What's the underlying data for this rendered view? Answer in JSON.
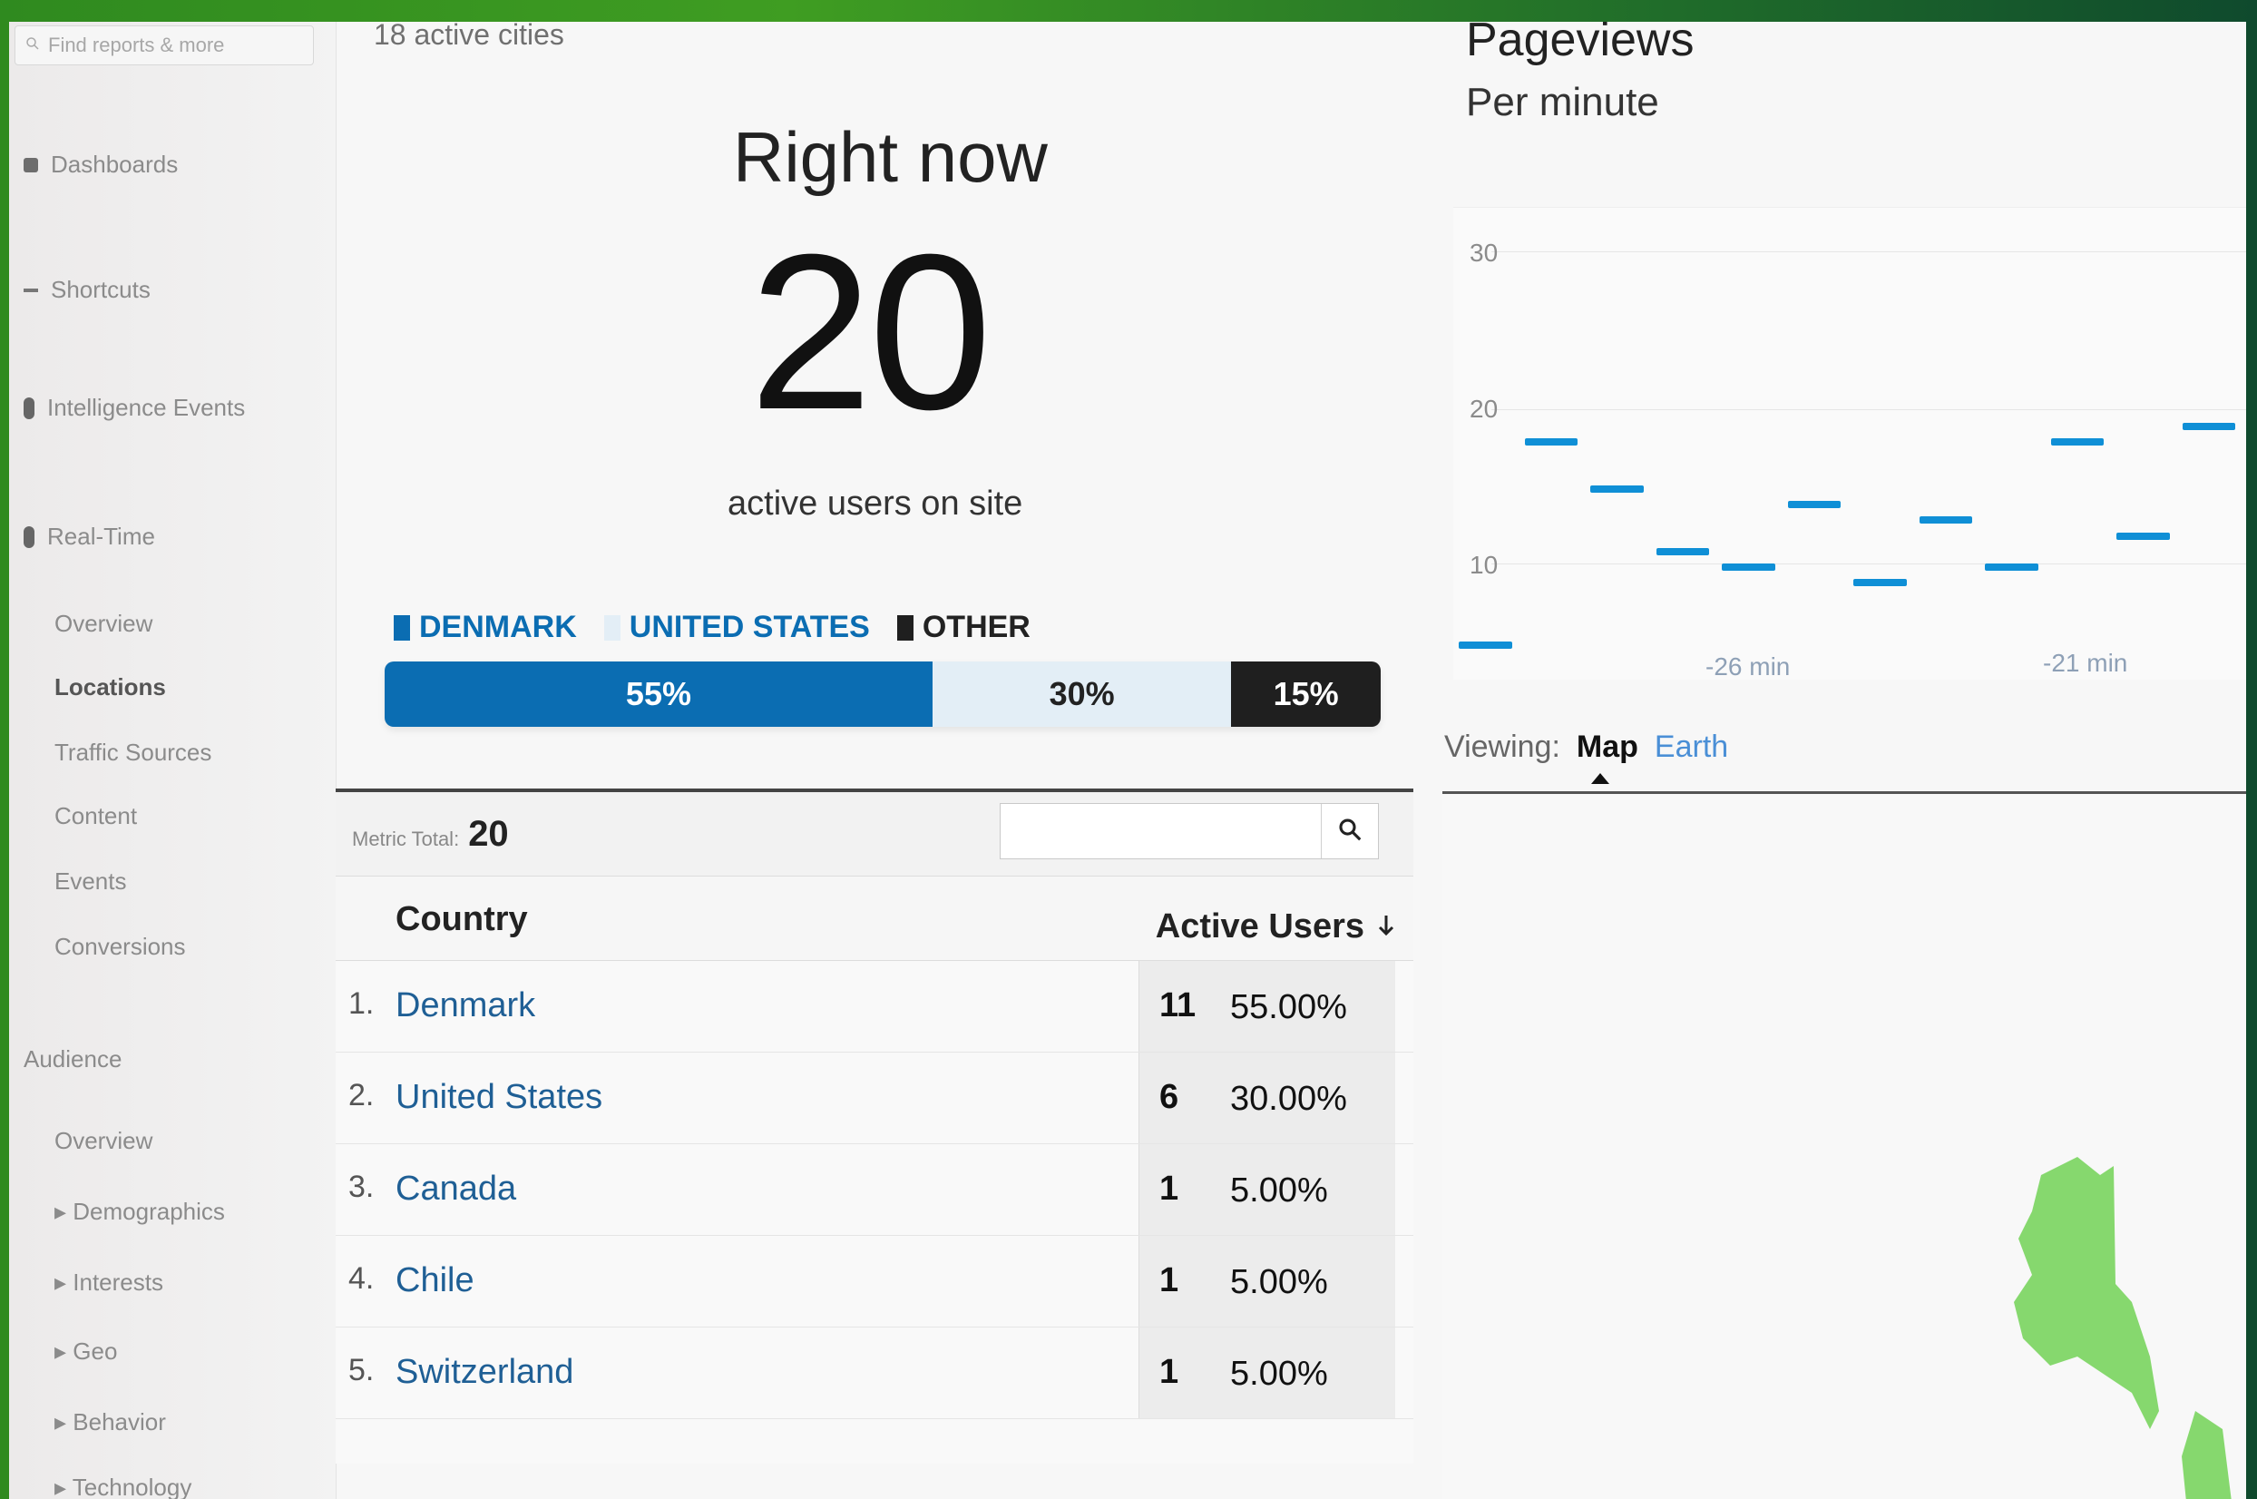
{
  "sidebar": {
    "search_placeholder": "Find reports & more",
    "items": [
      {
        "label": "Dashboards"
      },
      {
        "label": "Shortcuts"
      },
      {
        "label": "Intelligence Events"
      },
      {
        "label": "Real-Time"
      },
      {
        "label": "Overview"
      },
      {
        "label": "Locations"
      },
      {
        "label": "Traffic Sources"
      },
      {
        "label": "Content"
      },
      {
        "label": "Events"
      },
      {
        "label": "Conversions"
      },
      {
        "label": "Audience"
      },
      {
        "label": "Overview"
      },
      {
        "label": "▸ Demographics"
      },
      {
        "label": "▸ Interests"
      },
      {
        "label": "▸ Geo"
      },
      {
        "label": "▸ Behavior"
      },
      {
        "label": "▸ Technology"
      }
    ]
  },
  "summary": {
    "active_cities": "18 active cities",
    "right_now": "Right now",
    "count": "20",
    "subtitle": "active users on site"
  },
  "legend": [
    "DENMARK",
    "UNITED STATES",
    "OTHER"
  ],
  "share_bar": {
    "denmark": {
      "label": "55%",
      "value": 55,
      "color": "#0b6db2"
    },
    "united_states": {
      "label": "30%",
      "value": 30,
      "color": "#e3eef6"
    },
    "other": {
      "label": "15%",
      "value": 15,
      "color": "#1f1f1f"
    }
  },
  "table": {
    "metric_total_label": "Metric Total:",
    "metric_total_value": "20",
    "search_placeholder": "",
    "headers": {
      "country": "Country",
      "active_users": "Active Users"
    },
    "rows": [
      {
        "rank": "1.",
        "country": "Denmark",
        "users": "11",
        "pct": "55.00%"
      },
      {
        "rank": "2.",
        "country": "United States",
        "users": "6",
        "pct": "30.00%"
      },
      {
        "rank": "3.",
        "country": "Canada",
        "users": "1",
        "pct": "5.00%"
      },
      {
        "rank": "4.",
        "country": "Chile",
        "users": "1",
        "pct": "5.00%"
      },
      {
        "rank": "5.",
        "country": "Switzerland",
        "users": "1",
        "pct": "5.00%"
      }
    ]
  },
  "pageviews": {
    "title": "Pageviews",
    "subtitle": "Per minute",
    "ticks": [
      "30",
      "20",
      "10"
    ],
    "x_labels": [
      "-26 min",
      "-21 min"
    ]
  },
  "chart_data": {
    "type": "bar",
    "ylim": [
      0,
      30
    ],
    "values": [
      5,
      18,
      15,
      11,
      10,
      14,
      9,
      13,
      10,
      18,
      12,
      19
    ]
  },
  "viewing": {
    "label": "Viewing:",
    "map": "Map",
    "earth": "Earth"
  },
  "colors": {
    "accent": "#0b6db2",
    "link": "#1f5f95",
    "chart": "#0f8fd6",
    "map_region": "#86d86e"
  }
}
